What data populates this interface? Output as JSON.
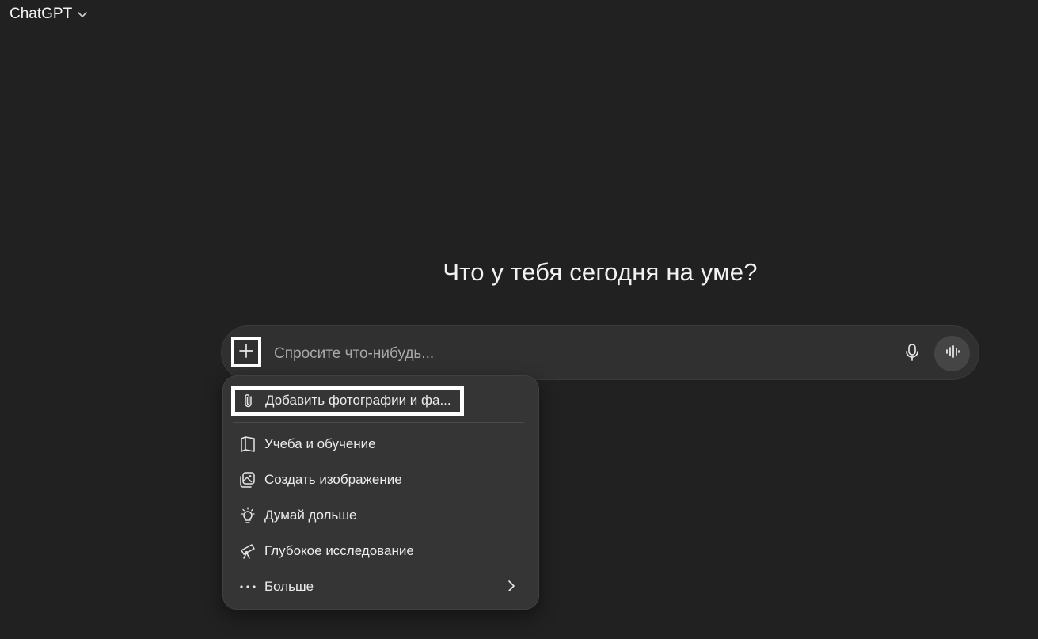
{
  "header": {
    "model_label": "ChatGPT"
  },
  "main": {
    "headline": "Что у тебя сегодня на уме?"
  },
  "composer": {
    "placeholder": "Спросите что-нибудь..."
  },
  "menu": {
    "items": [
      {
        "label": "Добавить фотографии и фа...",
        "icon": "paperclip-icon"
      },
      {
        "label": "Учеба и обучение",
        "icon": "book-icon"
      },
      {
        "label": "Создать изображение",
        "icon": "image-icon"
      },
      {
        "label": "Думай дольше",
        "icon": "lightbulb-icon"
      },
      {
        "label": "Глубокое исследование",
        "icon": "telescope-icon"
      },
      {
        "label": "Больше",
        "icon": "more-dots-icon"
      }
    ]
  },
  "colors": {
    "background": "#212121",
    "composer": "#303030",
    "menu": "#353535",
    "text": "#ececec",
    "placeholder": "#a8a8a8",
    "highlight_border": "#ffffff"
  }
}
